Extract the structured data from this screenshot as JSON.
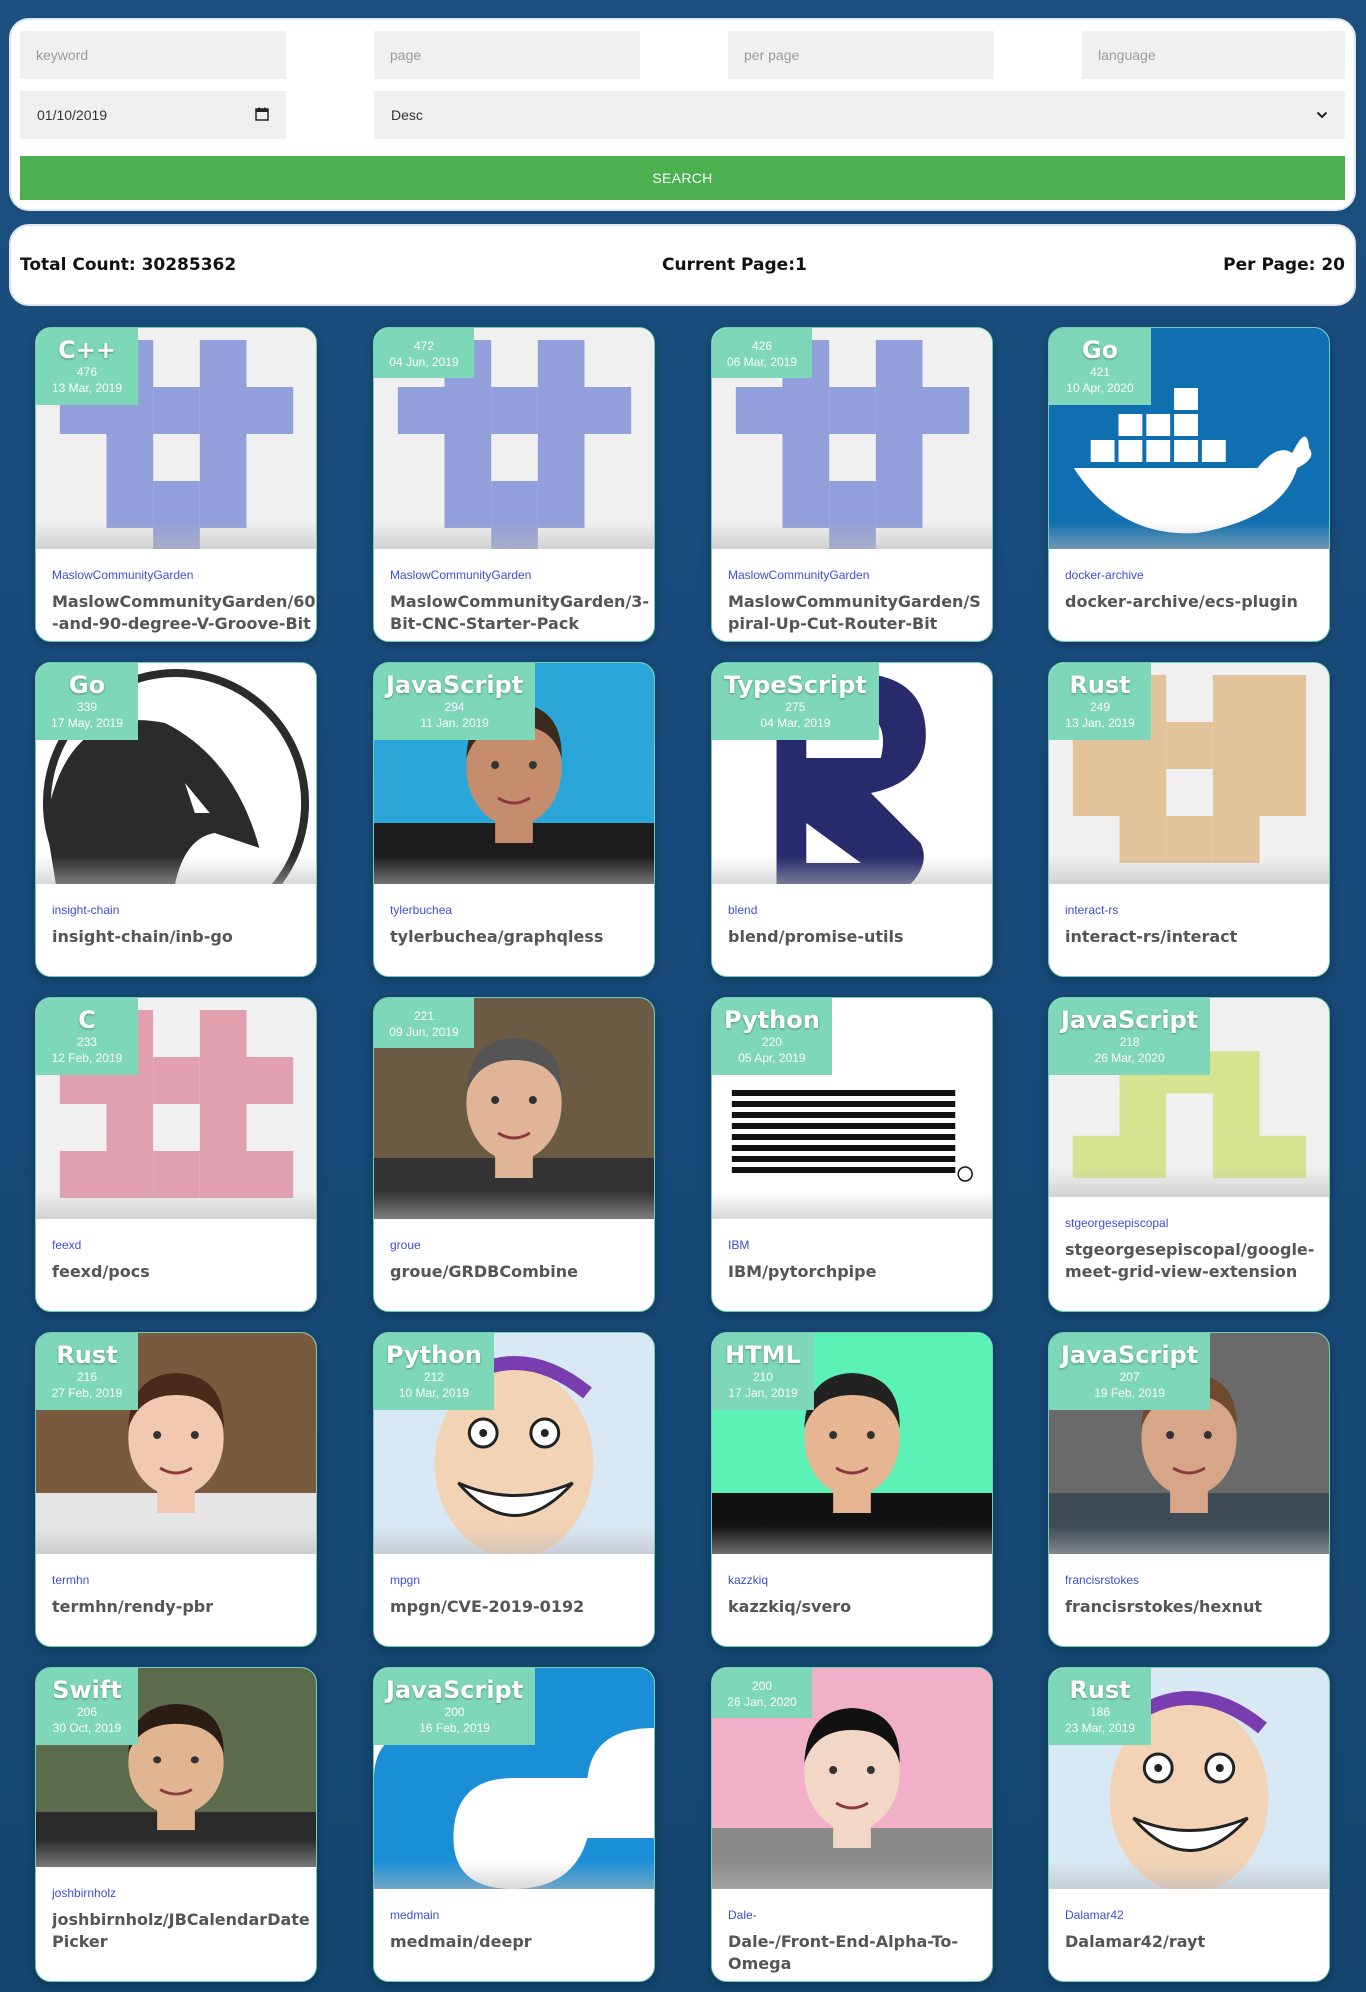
{
  "search": {
    "keyword_placeholder": "keyword",
    "page_placeholder": "page",
    "per_page_placeholder": "per page",
    "language_placeholder": "language",
    "date_value": "01/10/2019",
    "order_value": "Desc",
    "button_label": "SEARCH",
    "button_color": "#4caf50"
  },
  "stats": {
    "total": "Total Count: 30285362",
    "current_page": "Current Page:1",
    "per_page": "Per Page: 20"
  },
  "cards": [
    {
      "language": "C++",
      "count": "476",
      "date": "13 Mar, 2019",
      "owner": "MaslowCommunityGarden",
      "repo": "MaslowCommunityGarden/60-and-90-degree-V-Groove-Bit",
      "image": "identicon-blue"
    },
    {
      "language": "",
      "count": "472",
      "date": "04 Jun, 2019",
      "owner": "MaslowCommunityGarden",
      "repo": "MaslowCommunityGarden/3-Bit-CNC-Starter-Pack",
      "image": "identicon-blue"
    },
    {
      "language": "",
      "count": "426",
      "date": "06 Mar, 2019",
      "owner": "MaslowCommunityGarden",
      "repo": "MaslowCommunityGarden/Spiral-Up-Cut-Router-Bit",
      "image": "identicon-blue"
    },
    {
      "language": "Go",
      "count": "421",
      "date": "10 Apr, 2020",
      "owner": "docker-archive",
      "repo": "docker-archive/ecs-plugin",
      "image": "docker-whale-logo"
    },
    {
      "language": "Go",
      "count": "339",
      "date": "17 May, 2019",
      "owner": "insight-chain",
      "repo": "insight-chain/inb-go",
      "image": "eagle-logo"
    },
    {
      "language": "JavaScript",
      "count": "294",
      "date": "11 Jan, 2019",
      "owner": "tylerbuchea",
      "repo": "tylerbuchea/graphqless",
      "image": "avatar-photo"
    },
    {
      "language": "TypeScript",
      "count": "275",
      "date": "04 Mar, 2019",
      "owner": "blend",
      "repo": "blend/promise-utils",
      "image": "blend-logo"
    },
    {
      "language": "Rust",
      "count": "249",
      "date": "13 Jan, 2019",
      "owner": "interact-rs",
      "repo": "interact-rs/interact",
      "image": "identicon-tan"
    },
    {
      "language": "C",
      "count": "233",
      "date": "12 Feb, 2019",
      "owner": "feexd",
      "repo": "feexd/pocs",
      "image": "identicon-pink"
    },
    {
      "language": "",
      "count": "221",
      "date": "09 Jun, 2019",
      "owner": "groue",
      "repo": "groue/GRDBCombine",
      "image": "avatar-photo"
    },
    {
      "language": "Python",
      "count": "220",
      "date": "05 Apr, 2019",
      "owner": "IBM",
      "repo": "IBM/pytorchpipe",
      "image": "ibm-logo"
    },
    {
      "language": "JavaScript",
      "count": "218",
      "date": "26 Mar, 2020",
      "owner": "stgeorgesepiscopal",
      "repo": "stgeorgesepiscopal/google-meet-grid-view-extension",
      "image": "identicon-green"
    },
    {
      "language": "Rust",
      "count": "216",
      "date": "27 Feb, 2019",
      "owner": "termhn",
      "repo": "termhn/rendy-pbr",
      "image": "avatar-photo"
    },
    {
      "language": "Python",
      "count": "212",
      "date": "10 Mar, 2019",
      "owner": "mpgn",
      "repo": "mpgn/CVE-2019-0192",
      "image": "cartoon-avatar"
    },
    {
      "language": "HTML",
      "count": "210",
      "date": "17 Jan, 2019",
      "owner": "kazzkiq",
      "repo": "kazzkiq/svero",
      "image": "avatar-photo"
    },
    {
      "language": "JavaScript",
      "count": "207",
      "date": "19 Feb, 2019",
      "owner": "francisrstokes",
      "repo": "francisrstokes/hexnut",
      "image": "avatar-photo"
    },
    {
      "language": "Swift",
      "count": "206",
      "date": "30 Oct, 2019",
      "owner": "joshbirnholz",
      "repo": "joshbirnholz/JBCalendarDatePicker",
      "image": "avatar-photo"
    },
    {
      "language": "JavaScript",
      "count": "200",
      "date": "16 Feb, 2019",
      "owner": "medmain",
      "repo": "medmain/deepr",
      "image": "medmain-logo"
    },
    {
      "language": "",
      "count": "200",
      "date": "26 Jan, 2020",
      "owner": "Dale-",
      "repo": "Dale-/Front-End-Alpha-To-Omega",
      "image": "avatar-photo"
    },
    {
      "language": "Rust",
      "count": "186",
      "date": "23 Mar, 2019",
      "owner": "Dalamar42",
      "repo": "Dalamar42/rayt",
      "image": "cartoon-avatar"
    }
  ]
}
